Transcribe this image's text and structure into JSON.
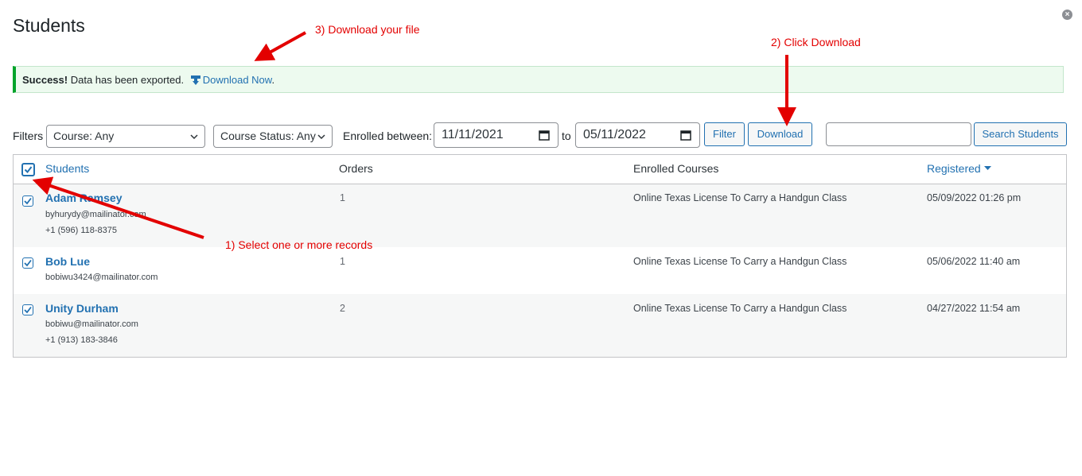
{
  "page": {
    "title": "Students"
  },
  "notice": {
    "strong": "Success!",
    "message": "Data has been exported.",
    "link": "Download Now",
    "link_suffix": "."
  },
  "filters": {
    "label": "Filters",
    "course": "Course: Any",
    "course_status": "Course Status: Any",
    "enrolled_label": "Enrolled between:",
    "date_from": "11/11/2021",
    "to_label": "to",
    "date_to": "05/11/2022",
    "filter_button": "Filter",
    "download_button": "Download",
    "search_value": "",
    "search_button": "Search Students"
  },
  "table": {
    "headers": {
      "students": "Students",
      "orders": "Orders",
      "courses": "Enrolled Courses",
      "registered": "Registered"
    },
    "rows": [
      {
        "name": "Adam Ramsey",
        "email": "byhurydy@mailinator.com",
        "phone": "+1 (596) 118-8375",
        "orders": "1",
        "course": "Online Texas License To Carry a Handgun Class",
        "registered": "05/09/2022 01:26 pm"
      },
      {
        "name": "Bob Lue",
        "email": "bobiwu3424@mailinator.com",
        "phone": "",
        "orders": "1",
        "course": "Online Texas License To Carry a Handgun Class",
        "registered": "05/06/2022 11:40 am"
      },
      {
        "name": "Unity Durham",
        "email": "bobiwu@mailinator.com",
        "phone": "+1 (913) 183-3846",
        "orders": "2",
        "course": "Online Texas License To Carry a Handgun Class",
        "registered": "04/27/2022 11:54 am"
      }
    ]
  },
  "annotations": {
    "step1": "1) Select one or more records",
    "step2": "2) Click Download",
    "step3": "3) Download your file"
  },
  "colors": {
    "link": "#2271b1",
    "annotation": "#e30000",
    "success": "#00a32a"
  }
}
